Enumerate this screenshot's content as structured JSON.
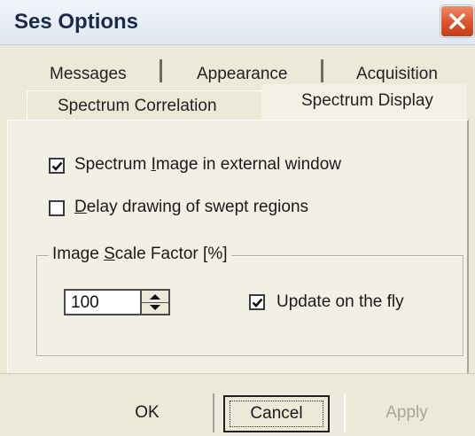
{
  "window": {
    "title": "Ses Options"
  },
  "tabs": {
    "row1": [
      {
        "label": "Messages"
      },
      {
        "label": "Appearance"
      },
      {
        "label": "Acquisition"
      }
    ],
    "row2": [
      {
        "label": "Spectrum Correlation"
      },
      {
        "label": "Spectrum Display",
        "selected": true
      }
    ]
  },
  "options": {
    "spectrum_image_external": {
      "label_before": "Spectrum ",
      "label_accel": "I",
      "label_after": "mage in external window",
      "checked": true
    },
    "delay_drawing": {
      "label_before": "",
      "label_accel": "D",
      "label_after": "elay drawing of swept regions",
      "checked": false
    }
  },
  "scale_group": {
    "title_before": "Image ",
    "title_accel": "S",
    "title_after": "cale Factor [%]",
    "value": "100",
    "update_on_fly": {
      "label": "Update on the fly",
      "checked": true
    }
  },
  "buttons": {
    "ok": "OK",
    "cancel": "Cancel",
    "apply": "Apply"
  },
  "icons": {
    "close": "close-icon",
    "check": "checkmark-icon",
    "spin_up": "arrow-up-icon",
    "spin_down": "arrow-down-icon"
  },
  "colors": {
    "close_button": "#d9532b",
    "dialog_face": "#ece9d8",
    "disabled_text": "#a7a598"
  }
}
